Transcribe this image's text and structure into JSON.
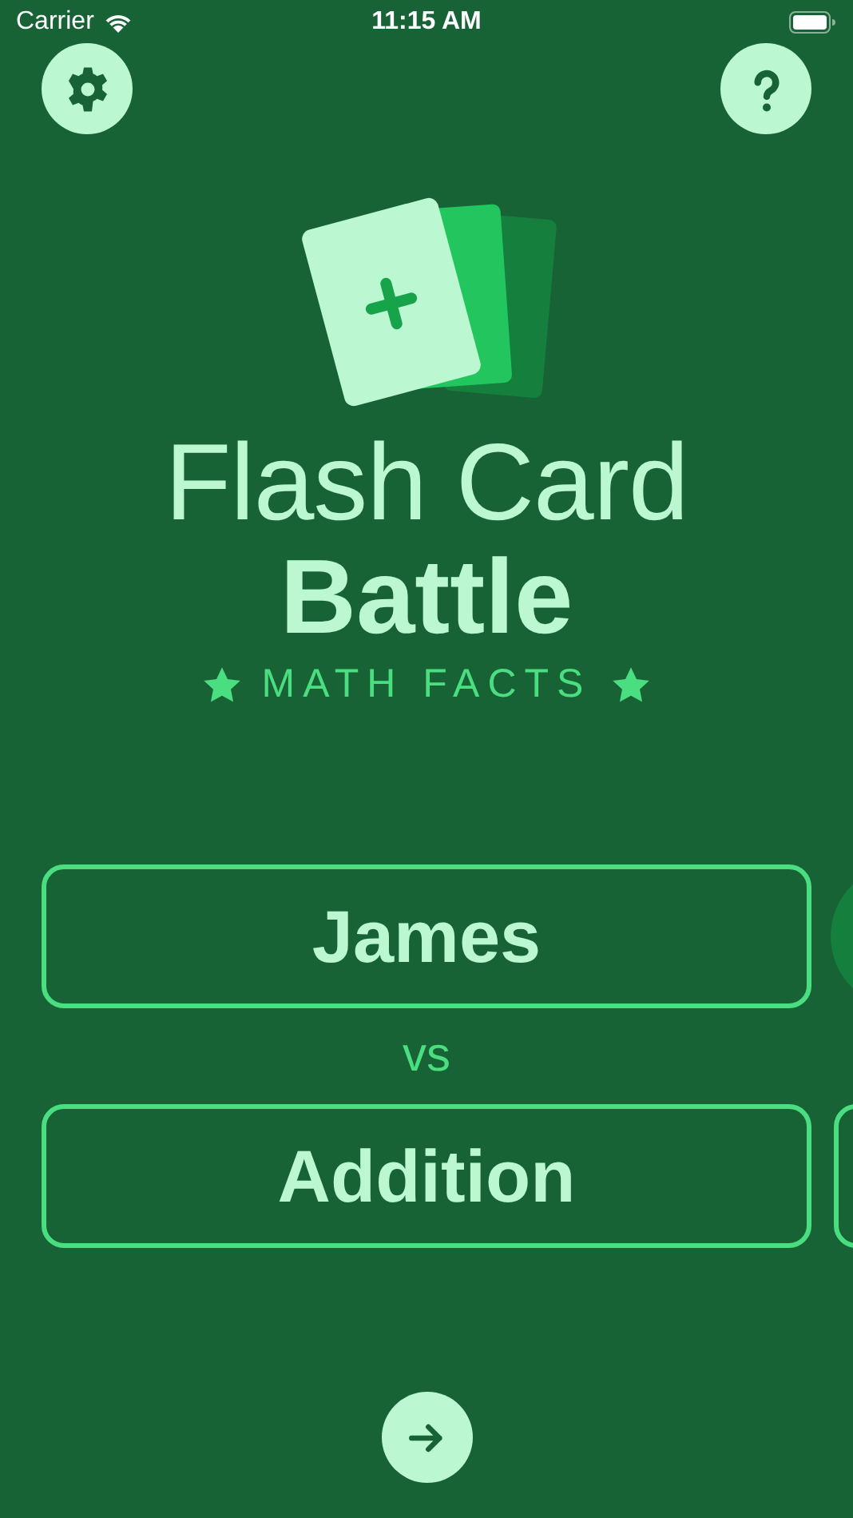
{
  "status_bar": {
    "carrier": "Carrier",
    "time": "11:15 AM"
  },
  "title": {
    "line_1": "Flash Card",
    "line_2": "Battle",
    "subtitle": "MATH FACTS"
  },
  "player": {
    "name": "James"
  },
  "versus": "vs",
  "mode": {
    "name": "Addition"
  }
}
